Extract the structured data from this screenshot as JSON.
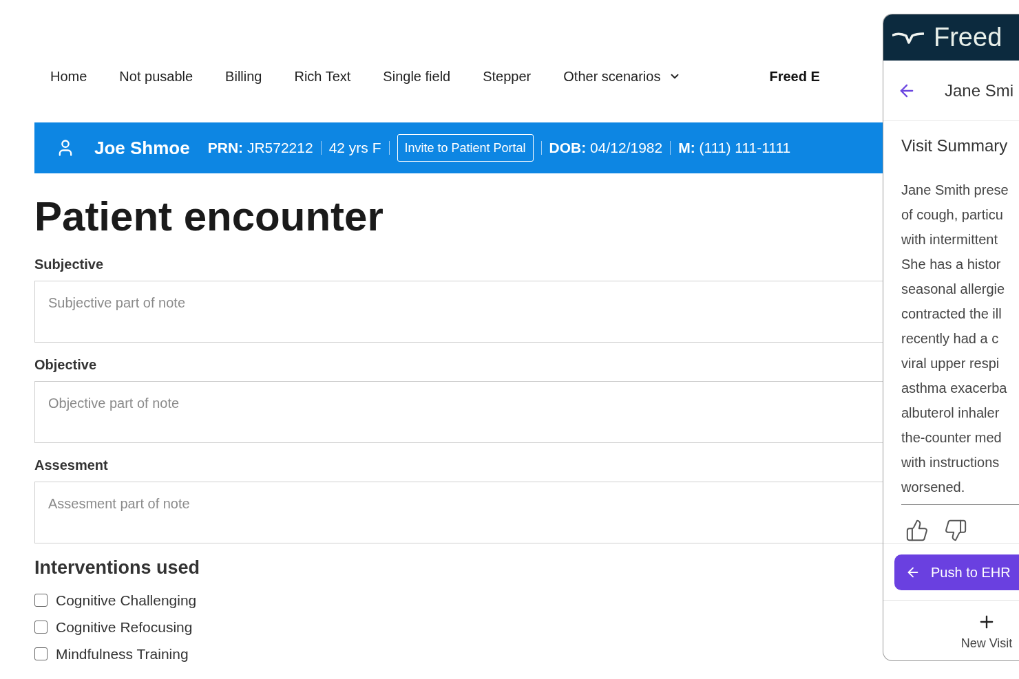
{
  "nav": {
    "items": [
      {
        "label": "Home",
        "kind": "link"
      },
      {
        "label": "Not pusable",
        "kind": "link"
      },
      {
        "label": "Billing",
        "kind": "link"
      },
      {
        "label": "Rich Text",
        "kind": "link"
      },
      {
        "label": "Single field",
        "kind": "link"
      },
      {
        "label": "Stepper",
        "kind": "link"
      },
      {
        "label": "Other scenarios",
        "kind": "dropdown"
      },
      {
        "label": "Freed E",
        "kind": "brand"
      }
    ]
  },
  "patient_bar": {
    "name": "Joe Shmoe",
    "items": [
      {
        "kind": "text",
        "text": "**PRN:** JR572212"
      },
      {
        "kind": "text",
        "text": "42 yrs F"
      },
      {
        "kind": "button",
        "text": "Invite to Patient Portal"
      },
      {
        "kind": "text",
        "text": "**DOB:** 04/12/1982"
      },
      {
        "kind": "text",
        "text": "**M:** (111) 111-1111"
      }
    ]
  },
  "form": {
    "title": "Patient encounter",
    "sections": [
      {
        "label": "Subjective",
        "placeholder": "Subjective part of note"
      },
      {
        "label": "Objective",
        "placeholder": "Objective part of note"
      },
      {
        "label": "Assesment",
        "placeholder": "Assesment part of note"
      }
    ],
    "interventions": {
      "title": "Interventions used",
      "options": [
        {
          "label": "Cognitive Challenging",
          "checked": false
        },
        {
          "label": "Cognitive Refocusing",
          "checked": false
        },
        {
          "label": "Mindfulness Training",
          "checked": false
        }
      ]
    }
  },
  "freed_panel": {
    "brand": "Freed",
    "patient_name": "Jane Smi",
    "section_title": "Visit Summary",
    "summary_lines": [
      "Jane Smith prese",
      "of cough, particu",
      "with intermittent",
      "She has a histor",
      "seasonal allergie",
      "contracted the ill",
      "recently had a c",
      "viral upper respi",
      "asthma exacerba",
      "albuterol inhaler",
      "the-counter med",
      "with instructions",
      "worsened."
    ],
    "push_button": "Push to EHR",
    "new_visit": "New Visit"
  }
}
